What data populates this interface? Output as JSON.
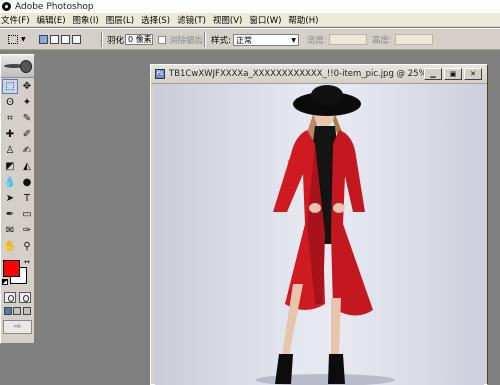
{
  "app": {
    "title": "Adobe Photoshop"
  },
  "menu": [
    {
      "label": "文件(F)",
      "name": "menu-file"
    },
    {
      "label": "编辑(E)",
      "name": "menu-edit"
    },
    {
      "label": "图象(I)",
      "name": "menu-image"
    },
    {
      "label": "图层(L)",
      "name": "menu-layer"
    },
    {
      "label": "选择(S)",
      "name": "menu-select"
    },
    {
      "label": "滤镜(T)",
      "name": "menu-filter"
    },
    {
      "label": "视图(V)",
      "name": "menu-view"
    },
    {
      "label": "窗口(W)",
      "name": "menu-window"
    },
    {
      "label": "帮助(H)",
      "name": "menu-help"
    }
  ],
  "options": {
    "feather_label": "羽化:",
    "feather_value": "0 像素",
    "antialias_label": "消除锯齿",
    "style_label": "样式:",
    "style_value": "正常",
    "width_label": "宽度:",
    "height_label": "高度:"
  },
  "colors": {
    "foreground": "#ff0000",
    "background": "#ffffff"
  },
  "document": {
    "title": "TB1CwXWJFXXXXa_XXXXXXXXXXXX_!!0-item_pic.jpg @ 25%(",
    "minimize_icon": "minimize-icon",
    "maximize_icon": "maximize-icon",
    "close_icon": "close-icon"
  }
}
